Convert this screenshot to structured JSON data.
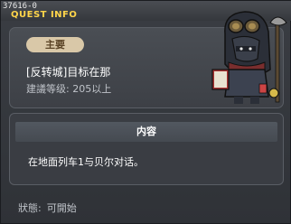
{
  "window": {
    "quest_id": "37616-0",
    "title": "QUEST INFO"
  },
  "summary": {
    "badge": "主要",
    "quest_name": "[反转城]目标在那",
    "required_level": "建議等级: 205以上"
  },
  "content": {
    "header": "内容",
    "text": "在地面列车1与贝尔对话。"
  },
  "status": {
    "label": "狀態:",
    "value": "可開始"
  },
  "colors": {
    "title": "#ffd54a",
    "badge_bg": "#d9c8a8",
    "badge_text": "#5b4426"
  }
}
